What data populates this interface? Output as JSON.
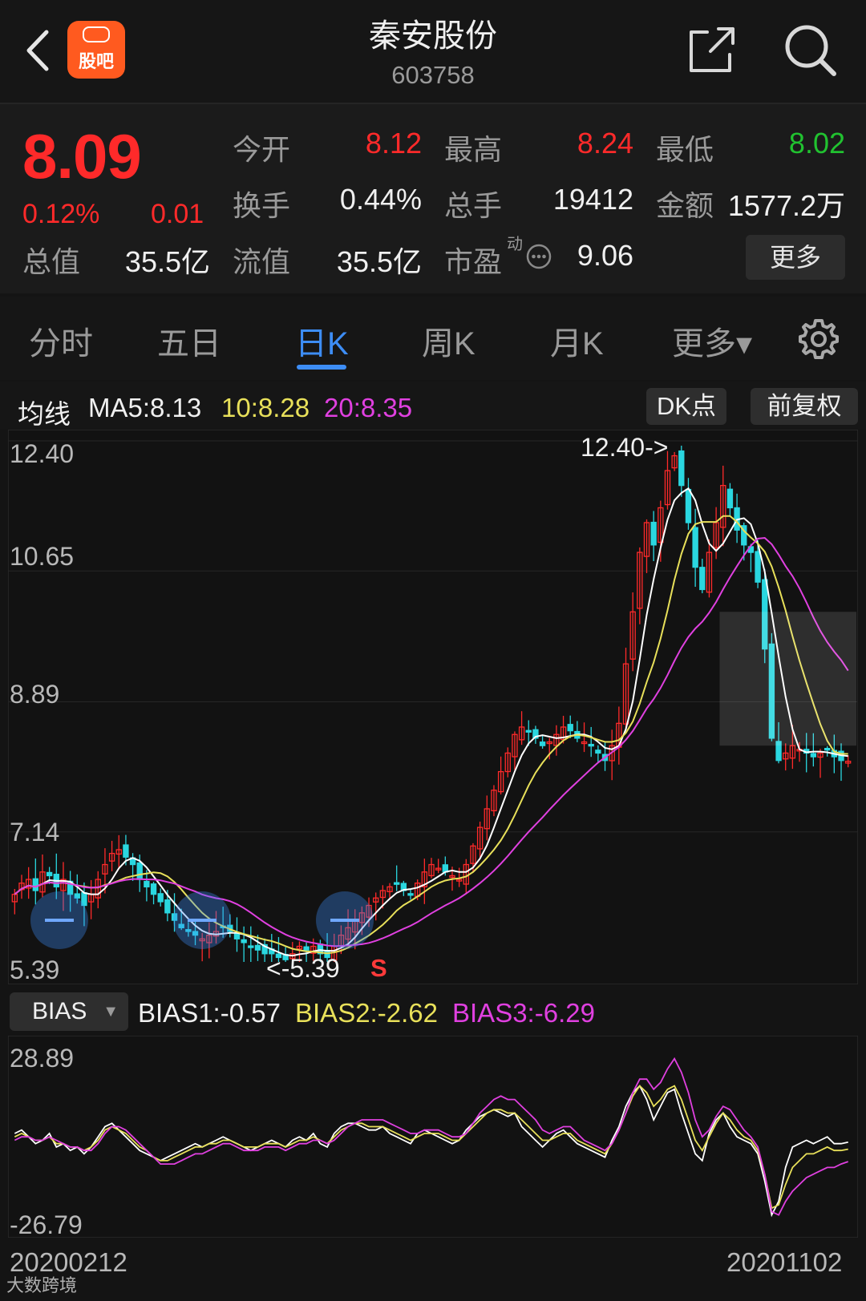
{
  "header": {
    "stock_name": "秦安股份",
    "stock_code": "603758",
    "logo_text": "股吧"
  },
  "quote": {
    "price": "8.09",
    "change_pct": "0.12%",
    "change": "0.01",
    "open_label": "今开",
    "open": "8.12",
    "high_label": "最高",
    "high": "8.24",
    "low_label": "最低",
    "low": "8.02",
    "turnover_label": "换手",
    "turnover": "0.44%",
    "volume_label": "总手",
    "volume": "19412",
    "amount_label": "金额",
    "amount": "1577.2万",
    "mcap_label": "总值",
    "mcap": "35.5亿",
    "float_label": "流值",
    "float_value": "35.5亿",
    "pe_label": "市盈",
    "pe_sup": "动",
    "pe": "9.06",
    "more_label": "更多"
  },
  "tabs": [
    {
      "label": "分时"
    },
    {
      "label": "五日"
    },
    {
      "label": "日K"
    },
    {
      "label": "周K"
    },
    {
      "label": "月K"
    },
    {
      "label": "更多▾"
    }
  ],
  "ma": {
    "label": "均线",
    "ma5": "MA5:8.13",
    "ma10": "10:8.28",
    "ma20": "20:8.35",
    "dk_button": "DK点",
    "adjust_button": "前复权"
  },
  "colors": {
    "up": "#ff2a2a",
    "down": "#2ad7e0",
    "ma5": "#ffffff",
    "ma10": "#e8e05a",
    "ma20": "#e040e0",
    "accent": "#3d8df5"
  },
  "kline": {
    "y_ticks": [
      "12.40",
      "10.65",
      "8.89",
      "7.14",
      "5.39"
    ],
    "ylim": [
      5.39,
      12.4
    ],
    "max_annotation": "12.40->",
    "min_annotation": "<-5.39",
    "sell_marker": "S"
  },
  "bias": {
    "selector": "BIAS",
    "bias1": "BIAS1:-0.57",
    "bias2": "BIAS2:-2.62",
    "bias3": "BIAS3:-6.29",
    "y_ticks": [
      "28.89",
      "-26.79"
    ],
    "ylim": [
      -26.79,
      28.89
    ]
  },
  "dates": {
    "start": "20200212",
    "end": "20201102"
  },
  "watermark": "大数跨境",
  "chart_data": [
    {
      "type": "candlestick",
      "title": "日K",
      "ylim": [
        5.39,
        12.4
      ],
      "close": [
        6.3,
        6.45,
        6.5,
        6.35,
        6.6,
        6.55,
        6.4,
        6.5,
        6.3,
        6.25,
        6.15,
        6.3,
        6.5,
        6.7,
        6.85,
        6.9,
        6.8,
        6.7,
        6.5,
        6.4,
        6.3,
        6.2,
        6.05,
        5.95,
        5.85,
        5.8,
        5.75,
        5.7,
        5.75,
        5.8,
        5.85,
        5.8,
        5.7,
        5.65,
        5.6,
        5.55,
        5.5,
        5.5,
        5.45,
        5.42,
        5.5,
        5.6,
        5.55,
        5.6,
        5.5,
        5.45,
        5.6,
        5.75,
        5.85,
        5.95,
        6.05,
        6.15,
        6.25,
        6.35,
        6.4,
        6.45,
        6.35,
        6.3,
        6.45,
        6.6,
        6.7,
        6.65,
        6.6,
        6.55,
        6.5,
        6.7,
        6.95,
        7.2,
        7.45,
        7.7,
        7.95,
        8.2,
        8.45,
        8.55,
        8.5,
        8.4,
        8.3,
        8.35,
        8.45,
        8.55,
        8.5,
        8.4,
        8.35,
        8.3,
        8.2,
        8.1,
        8.3,
        8.6,
        9.4,
        10.1,
        10.9,
        11.3,
        11.0,
        11.5,
        12.0,
        12.2,
        11.8,
        11.3,
        10.7,
        10.4,
        10.9,
        11.3,
        11.8,
        11.5,
        11.2,
        11.0,
        10.9,
        10.5,
        9.6,
        8.4,
        8.1,
        8.2,
        8.3,
        8.25,
        8.2,
        8.15,
        8.2,
        8.25,
        8.15,
        8.1,
        8.09
      ],
      "ma_labels": [
        "MA5:8.13",
        "10:8.28",
        "20:8.35"
      ]
    },
    {
      "type": "line",
      "title": "BIAS",
      "ylim": [
        -26.79,
        28.89
      ],
      "series": [
        {
          "name": "BIAS1:-0.57",
          "values": [
            2,
            3,
            1,
            -1,
            0,
            2,
            -2,
            -1,
            -3,
            -2,
            -4,
            -2,
            1,
            4,
            5,
            3,
            1,
            -1,
            -3,
            -4,
            -5,
            -6,
            -5,
            -4,
            -3,
            -2,
            -1,
            -2,
            -1,
            0,
            1,
            0,
            -1,
            -2,
            -3,
            -2,
            -1,
            0,
            -1,
            -2,
            0,
            1,
            0,
            2,
            -1,
            -2,
            2,
            4,
            5,
            5,
            4,
            3,
            3,
            4,
            2,
            1,
            0,
            -1,
            2,
            3,
            2,
            1,
            0,
            -1,
            0,
            3,
            5,
            7,
            8,
            9,
            8,
            7,
            8,
            4,
            2,
            0,
            -2,
            0,
            2,
            3,
            1,
            -1,
            -2,
            -3,
            -4,
            -5,
            0,
            4,
            10,
            14,
            16,
            12,
            6,
            10,
            14,
            15,
            8,
            2,
            -4,
            -6,
            2,
            6,
            8,
            4,
            1,
            0,
            -1,
            -4,
            -12,
            -22,
            -18,
            -8,
            -2,
            -1,
            0,
            -1,
            0,
            1,
            -1,
            -1,
            -0.57
          ]
        },
        {
          "name": "BIAS2:-2.62",
          "values": [
            1,
            2,
            1,
            0,
            0,
            1,
            -1,
            -1,
            -2,
            -2,
            -3,
            -2,
            0,
            3,
            4,
            3,
            2,
            0,
            -2,
            -3,
            -5,
            -6,
            -6,
            -5,
            -4,
            -3,
            -2,
            -2,
            -1,
            -1,
            0,
            0,
            -1,
            -2,
            -2,
            -2,
            -1,
            -1,
            -1,
            -2,
            -1,
            0,
            0,
            1,
            0,
            -1,
            1,
            3,
            4,
            5,
            5,
            4,
            4,
            4,
            3,
            2,
            1,
            0,
            1,
            2,
            2,
            2,
            1,
            0,
            0,
            2,
            4,
            6,
            8,
            9,
            9,
            8,
            8,
            6,
            4,
            2,
            0,
            0,
            1,
            2,
            2,
            0,
            -1,
            -2,
            -3,
            -4,
            -1,
            3,
            8,
            13,
            16,
            14,
            10,
            12,
            15,
            16,
            12,
            6,
            0,
            -3,
            1,
            5,
            8,
            6,
            3,
            1,
            0,
            -3,
            -10,
            -20,
            -19,
            -13,
            -8,
            -6,
            -4,
            -4,
            -3,
            -2,
            -3,
            -3,
            -2.62
          ]
        },
        {
          "name": "BIAS3:-6.29",
          "values": [
            0,
            1,
            1,
            0,
            0,
            1,
            0,
            -1,
            -2,
            -2,
            -3,
            -3,
            -1,
            2,
            4,
            4,
            3,
            1,
            -1,
            -3,
            -5,
            -7,
            -7,
            -7,
            -6,
            -5,
            -4,
            -4,
            -3,
            -2,
            -1,
            -1,
            -2,
            -3,
            -3,
            -3,
            -2,
            -2,
            -2,
            -3,
            -2,
            -1,
            -1,
            0,
            0,
            -1,
            0,
            2,
            4,
            5,
            6,
            6,
            6,
            6,
            5,
            4,
            3,
            2,
            2,
            3,
            3,
            3,
            2,
            1,
            1,
            2,
            5,
            8,
            10,
            12,
            13,
            12,
            12,
            10,
            8,
            6,
            3,
            2,
            3,
            4,
            4,
            2,
            0,
            -1,
            -2,
            -3,
            -1,
            3,
            8,
            14,
            18,
            18,
            15,
            17,
            21,
            24,
            20,
            14,
            6,
            1,
            3,
            7,
            10,
            9,
            6,
            3,
            1,
            -2,
            -10,
            -21,
            -22,
            -18,
            -15,
            -13,
            -11,
            -10,
            -9,
            -8,
            -8,
            -7,
            -6.29
          ]
        }
      ]
    }
  ]
}
